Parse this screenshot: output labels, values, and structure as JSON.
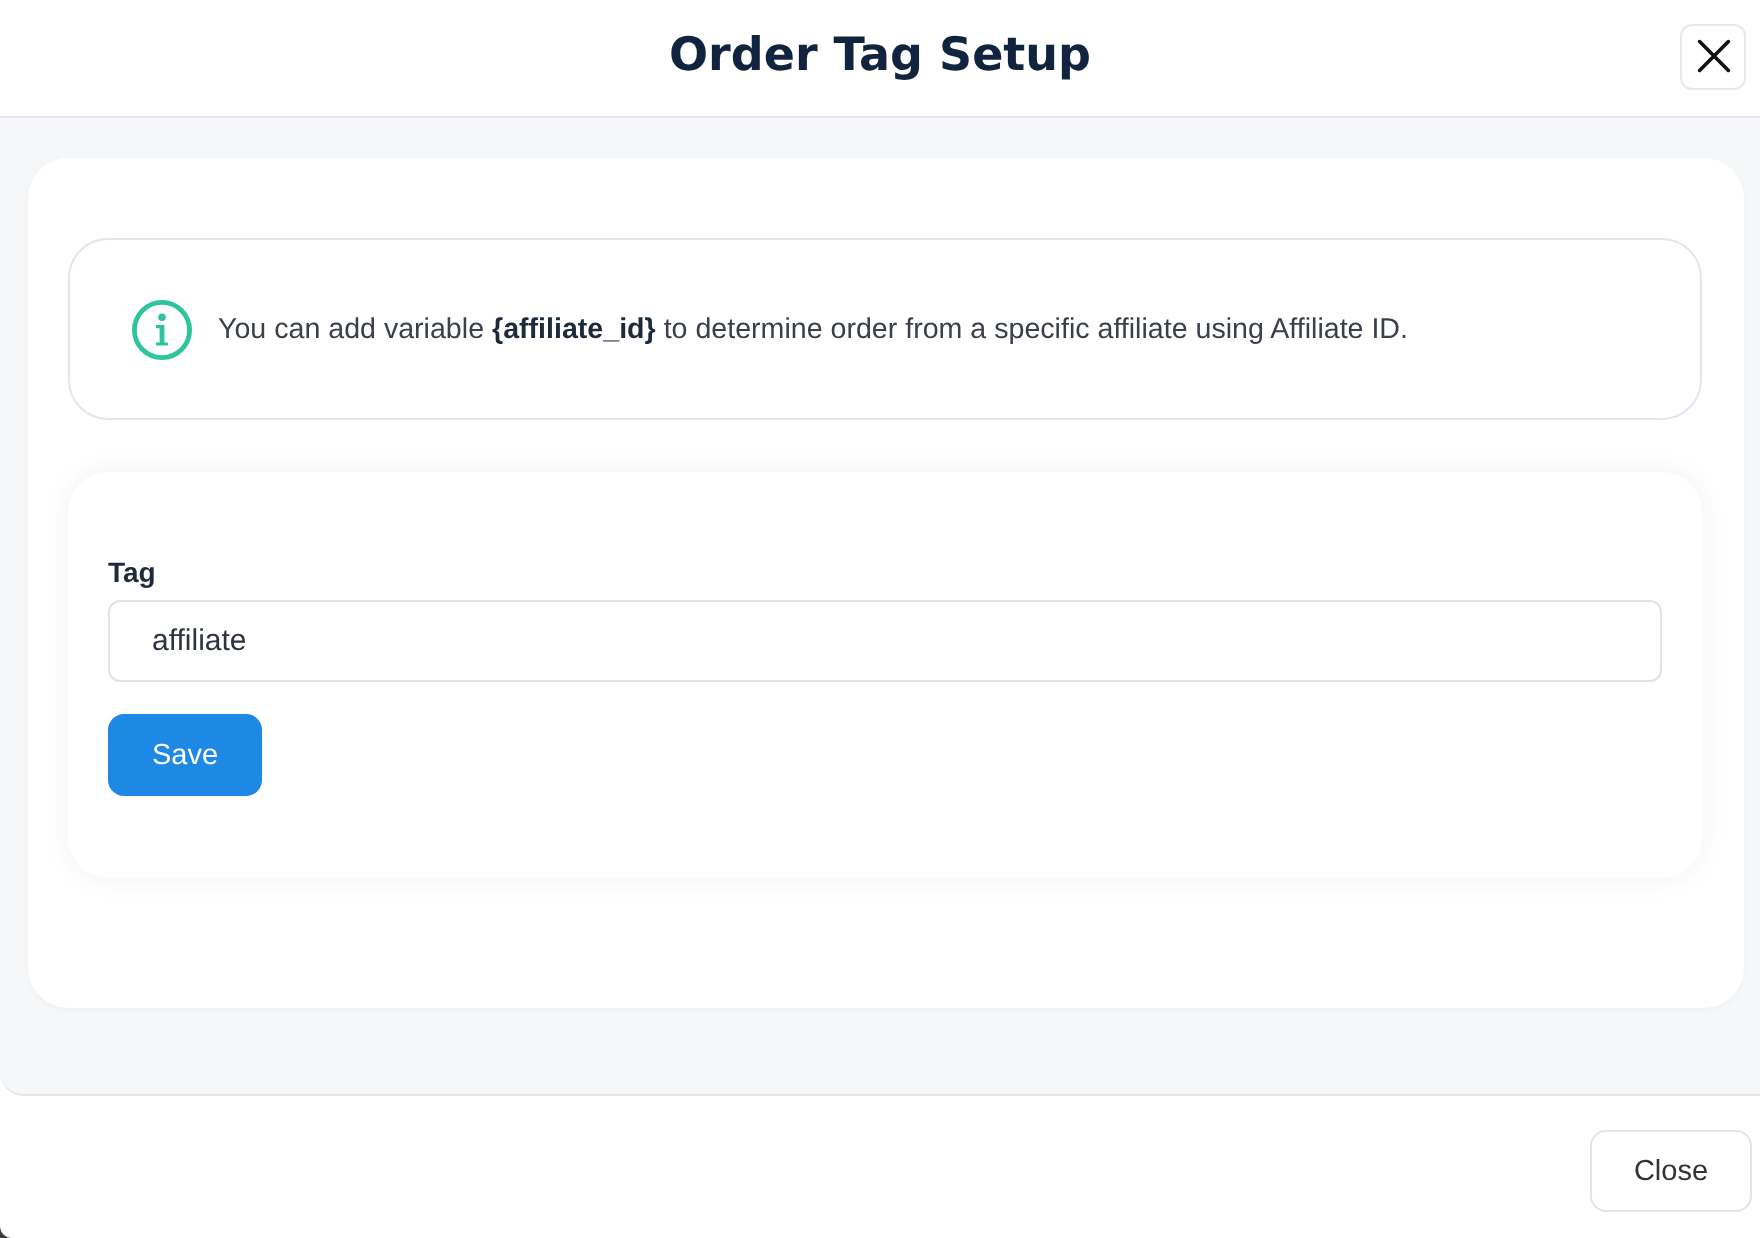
{
  "window": {
    "title": "Order Tag Setup"
  },
  "info": {
    "text": "You can add variable **{affiliate_id}** to determine order from a specific affiliate using Affiliate ID."
  },
  "form": {
    "field": {
      "label": "Tag",
      "value": "affiliate"
    },
    "buttons": [
      {
        "label": "Save",
        "kind": "primary"
      }
    ]
  },
  "footer": {
    "buttons": [
      {
        "label": "Close",
        "kind": "secondary"
      }
    ]
  }
}
